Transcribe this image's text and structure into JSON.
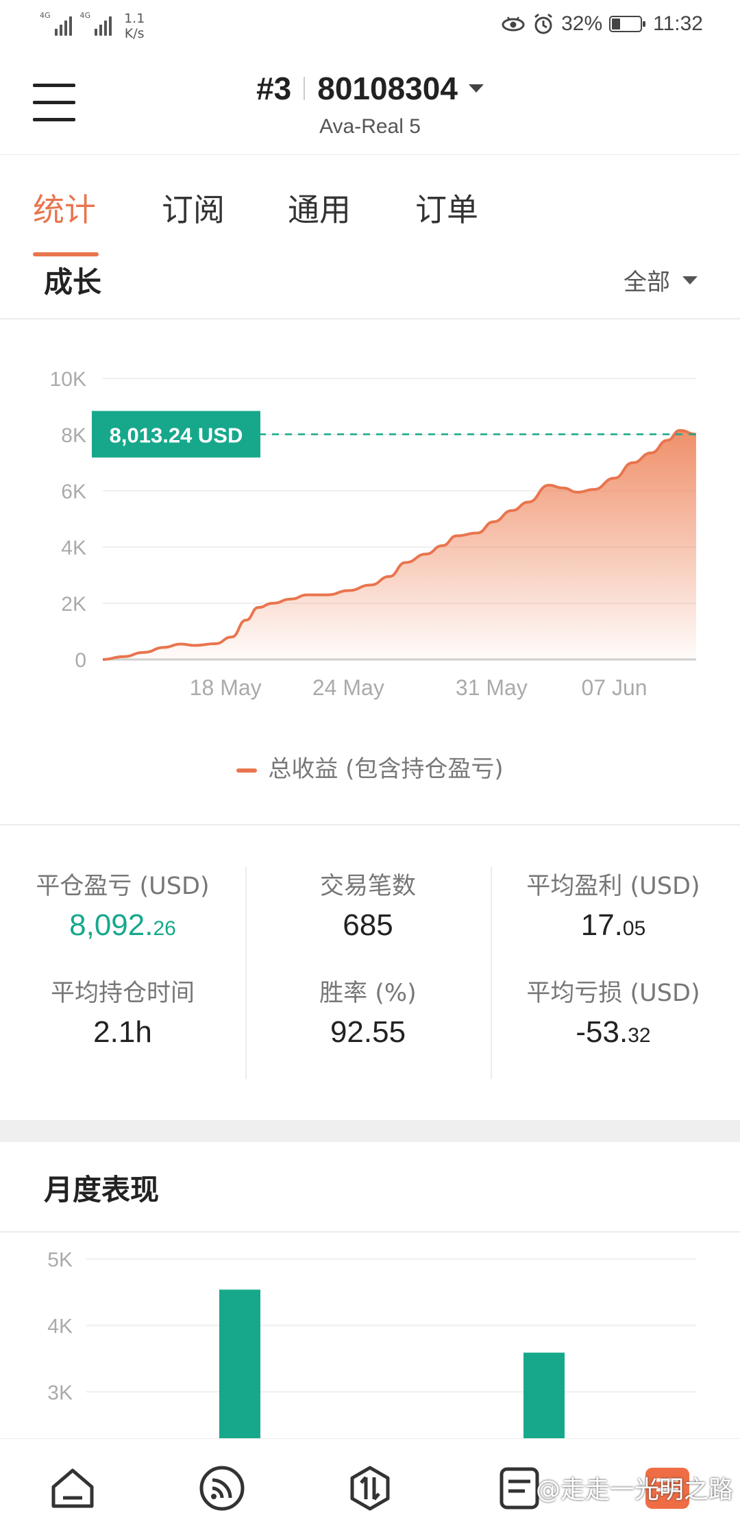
{
  "status_bar": {
    "sim1": "4G",
    "sim2": "4G",
    "net_speed_value": "1.1",
    "net_speed_unit": "K/s",
    "battery": "32%",
    "time": "11:32"
  },
  "header": {
    "account_index": "#3",
    "account_number": "80108304",
    "server": "Ava-Real 5"
  },
  "tabs": [
    {
      "label": "统计",
      "active": true
    },
    {
      "label": "订阅",
      "active": false
    },
    {
      "label": "通用",
      "active": false
    },
    {
      "label": "订单",
      "active": false
    }
  ],
  "growth": {
    "title": "成长",
    "filter": "全部"
  },
  "chart_data": [
    {
      "type": "area",
      "y_ticks": [
        "0",
        "2K",
        "4K",
        "6K",
        "8K",
        "10K"
      ],
      "ylim": [
        0,
        10000
      ],
      "x_tick_labels": [
        "18 May",
        "24 May",
        "31 May",
        "07 Jun"
      ],
      "x_tick_days": [
        6,
        12,
        19,
        25
      ],
      "x_range_days": [
        0,
        29
      ],
      "x_start_date": "12 May",
      "highlight_value": 8013.24,
      "highlight_label": "8,013.24 USD",
      "series": [
        {
          "name": "总收益 (包含持仓盈亏)",
          "color": "#e8754e",
          "points": [
            [
              0,
              0
            ],
            [
              1,
              100
            ],
            [
              2,
              250
            ],
            [
              3,
              430
            ],
            [
              3.8,
              550
            ],
            [
              4.5,
              500
            ],
            [
              5.5,
              560
            ],
            [
              6.3,
              800
            ],
            [
              7,
              1400
            ],
            [
              7.6,
              1850
            ],
            [
              8.3,
              2000
            ],
            [
              9.2,
              2150
            ],
            [
              10,
              2300
            ],
            [
              11,
              2300
            ],
            [
              12,
              2450
            ],
            [
              13.1,
              2650
            ],
            [
              14,
              2950
            ],
            [
              14.8,
              3450
            ],
            [
              15.8,
              3750
            ],
            [
              16.6,
              4050
            ],
            [
              17.3,
              4400
            ],
            [
              18.3,
              4500
            ],
            [
              19.1,
              4900
            ],
            [
              20,
              5300
            ],
            [
              20.8,
              5600
            ],
            [
              21.8,
              6200
            ],
            [
              22.5,
              6100
            ],
            [
              23.2,
              5950
            ],
            [
              24,
              6050
            ],
            [
              25,
              6450
            ],
            [
              25.9,
              7000
            ],
            [
              26.8,
              7350
            ],
            [
              27.6,
              7800
            ],
            [
              28.2,
              8150
            ],
            [
              29,
              8013
            ]
          ]
        }
      ]
    },
    {
      "type": "bar",
      "y_ticks": [
        "3K",
        "4K",
        "5K"
      ],
      "visible_y_range": [
        2300,
        5400
      ],
      "series": [
        {
          "color": "#17a88c",
          "values": [
            4540,
            3590
          ]
        }
      ]
    }
  ],
  "stats": [
    [
      {
        "label": "平仓盈亏 (USD)",
        "int": "8,092.",
        "dec": "26",
        "green": true
      },
      {
        "label": "平均持仓时间",
        "int": "2.1h",
        "dec": "",
        "green": false
      }
    ],
    [
      {
        "label": "交易笔数",
        "int": "685",
        "dec": "",
        "green": false
      },
      {
        "label": "胜率 (%)",
        "int": "92.55",
        "dec": "",
        "green": false
      }
    ],
    [
      {
        "label": "平均盈利 (USD)",
        "int": "17.",
        "dec": "05",
        "green": false
      },
      {
        "label": "平均亏损 (USD)",
        "int": "-53.",
        "dec": "32",
        "green": false
      }
    ]
  ],
  "monthly": {
    "title": "月度表现"
  },
  "watermark": "@走走一光明之路"
}
